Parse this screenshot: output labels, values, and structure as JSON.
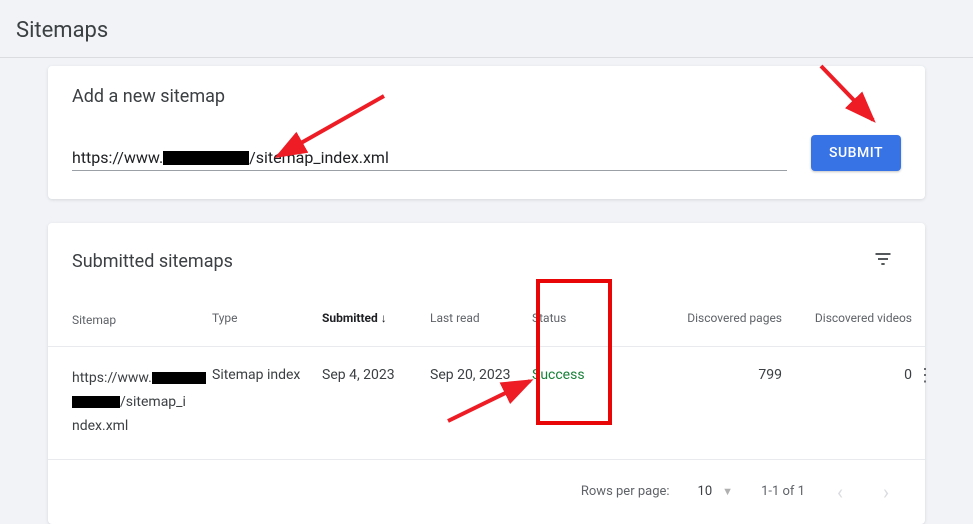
{
  "page": {
    "title": "Sitemaps"
  },
  "addCard": {
    "title": "Add a new sitemap",
    "urlPrefix": "https://www.",
    "urlSuffix": "/sitemap_index.xml",
    "submitLabel": "SUBMIT"
  },
  "listCard": {
    "title": "Submitted sitemaps",
    "headers": {
      "sitemap": "Sitemap",
      "type": "Type",
      "submitted": "Submitted",
      "lastRead": "Last read",
      "status": "Status",
      "pages": "Discovered pages",
      "videos": "Discovered videos"
    },
    "rows": [
      {
        "sitemapPrefix": "https://www.",
        "sitemapSuffix": "/sitemap_index.xml",
        "type": "Sitemap index",
        "submitted": "Sep 4, 2023",
        "lastRead": "Sep 20, 2023",
        "status": "Success",
        "pages": "799",
        "videos": "0"
      }
    ]
  },
  "pagination": {
    "rowsPerPageLabel": "Rows per page:",
    "rowsPerPage": "10",
    "rangeText": "1-1 of 1"
  }
}
